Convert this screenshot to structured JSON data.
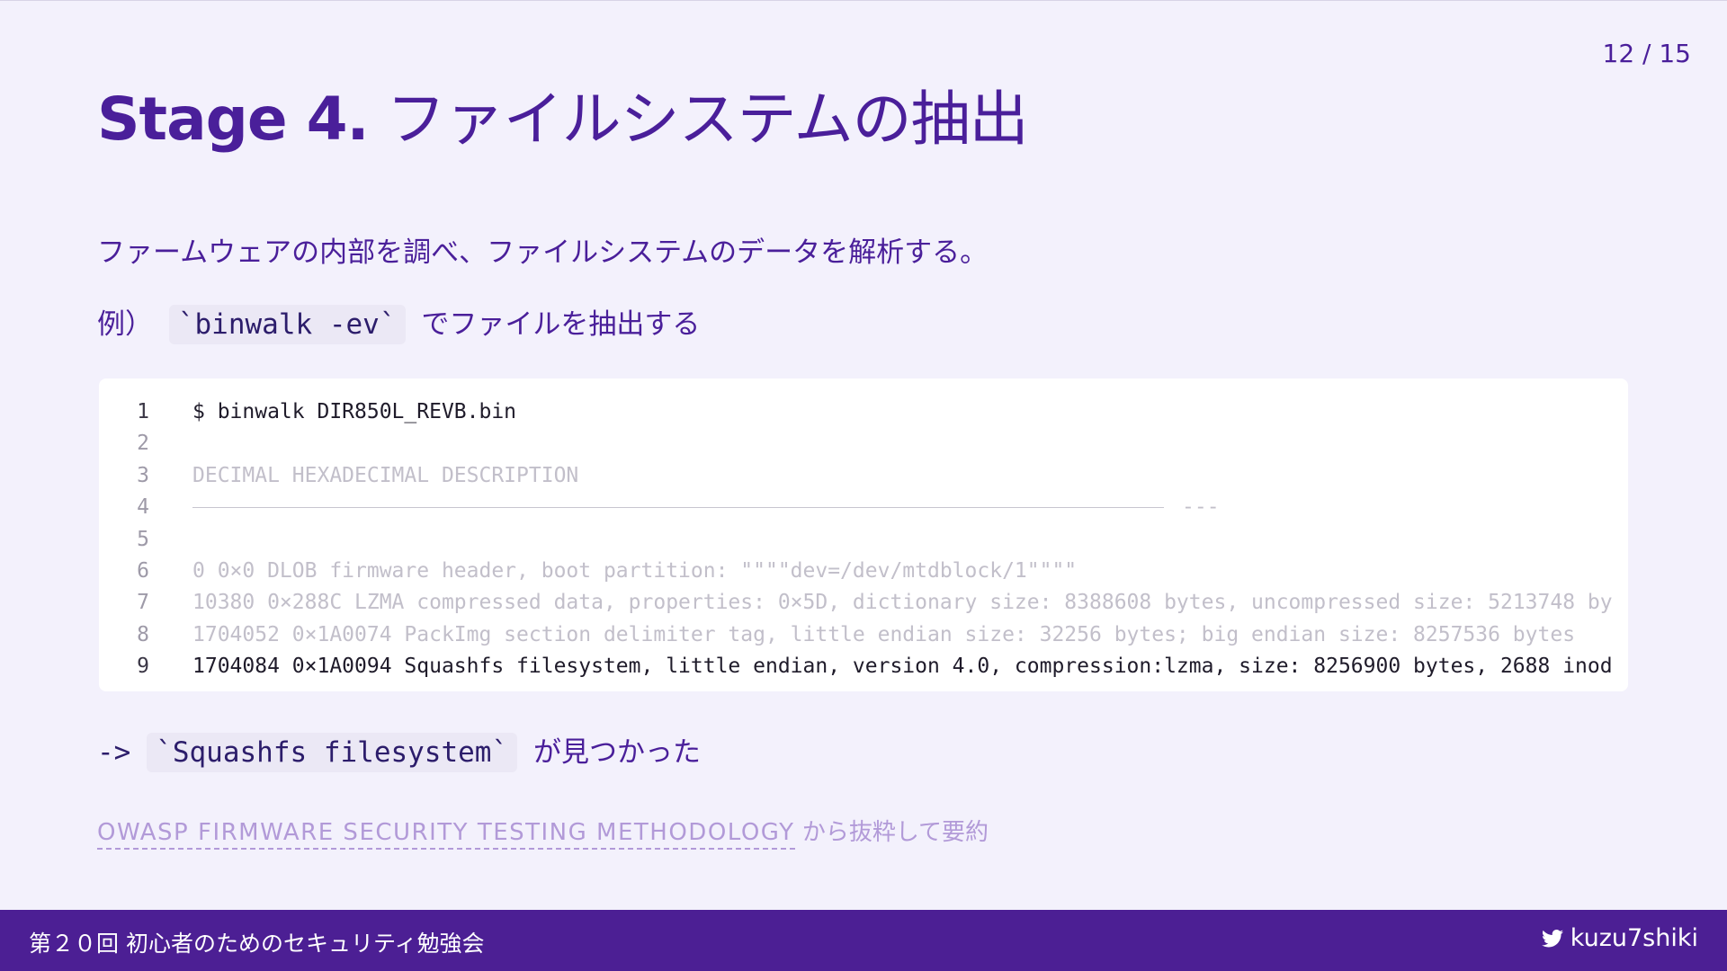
{
  "page_number": "12 / 15",
  "title": {
    "stage": "Stage 4.",
    "rest": "ファイルシステムの抽出"
  },
  "description": "ファームウェアの内部を調べ、ファイルシステムのデータを解析する。",
  "example": {
    "prefix": "例）",
    "code": "`binwalk -ev`",
    "suffix": "でファイルを抽出する"
  },
  "code_block": {
    "lines": [
      {
        "num": "1",
        "text": "$ binwalk DIR850L_REVB.bin"
      },
      {
        "num": "2",
        "text": ""
      },
      {
        "num": "3",
        "text": "DECIMAL HEXADECIMAL DESCRIPTION"
      },
      {
        "num": "4",
        "text": "---"
      },
      {
        "num": "5",
        "text": ""
      },
      {
        "num": "6",
        "text": "0 0×0 DLOB firmware header, boot partition: \"\"\"\"dev=/dev/mtdblock/1\"\"\"\""
      },
      {
        "num": "7",
        "text": "10380 0×288C LZMA compressed data, properties: 0×5D, dictionary size: 8388608 bytes, uncompressed size: 5213748 by"
      },
      {
        "num": "8",
        "text": "1704052 0×1A0074 PackImg section delimiter tag, little endian size: 32256 bytes; big endian size: 8257536 bytes"
      },
      {
        "num": "9",
        "text": "1704084 0×1A0094 Squashfs filesystem, little endian, version 4.0, compression:lzma, size: 8256900 bytes, 2688 inod"
      }
    ]
  },
  "result": {
    "arrow": "->",
    "code": "`Squashfs filesystem`",
    "suffix": "が見つかった"
  },
  "source": {
    "link_text": "OWASP FIRMWARE SECURITY TESTING METHODOLOGY",
    "suffix": "から抜粋して要約"
  },
  "footer": {
    "event": "第２０回 初心者のためのセキュリティ勉強会",
    "handle": "kuzu7shiki",
    "icon": "twitter-icon"
  }
}
